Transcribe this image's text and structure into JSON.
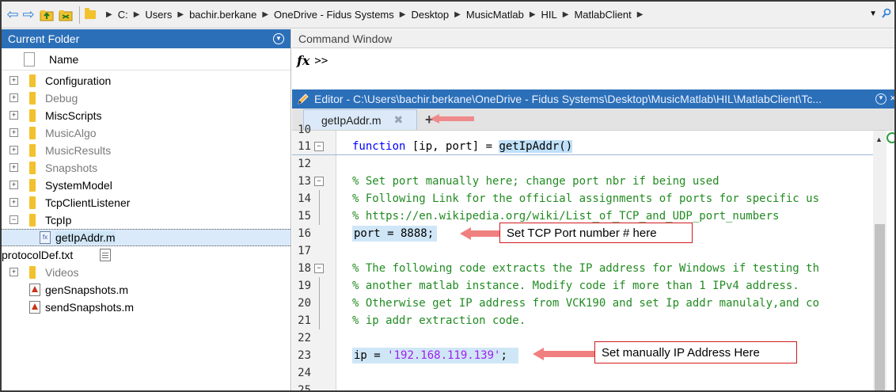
{
  "addressbar": {
    "breadcrumbs": [
      "C:",
      "Users",
      "bachir.berkane",
      "OneDrive - Fidus Systems",
      "Desktop",
      "MusicMatlab",
      "HIL",
      "MatlabClient"
    ]
  },
  "current_folder": {
    "title": "Current Folder",
    "column_name": "Name",
    "items": [
      {
        "label": "Configuration",
        "type": "folder"
      },
      {
        "label": "Debug",
        "type": "folder"
      },
      {
        "label": "MiscScripts",
        "type": "folder"
      },
      {
        "label": "MusicAlgo",
        "type": "folder"
      },
      {
        "label": "MusicResults",
        "type": "folder"
      },
      {
        "label": "Snapshots",
        "type": "folder"
      },
      {
        "label": "SystemModel",
        "type": "folder"
      },
      {
        "label": "TcpClientListener",
        "type": "folder"
      },
      {
        "label": "TcpIp",
        "type": "folder"
      },
      {
        "label": "getIpAddr.m",
        "type": "mfile"
      },
      {
        "label": "protocolDef.txt",
        "type": "txt"
      },
      {
        "label": "Videos",
        "type": "folder"
      },
      {
        "label": "genSnapshots.m",
        "type": "script"
      },
      {
        "label": "sendSnapshots.m",
        "type": "script"
      }
    ]
  },
  "command_window": {
    "title": "Command Window",
    "fx": "fx",
    "prompt": ">>"
  },
  "editor": {
    "title": "Editor - C:\\Users\\bachir.berkane\\OneDrive - Fidus Systems\\Desktop\\MusicMatlab\\HIL\\MatlabClient\\Tc...",
    "tab_label": "getIpAddr.m",
    "tab_close": "✖",
    "tab_add": "+",
    "line_numbers": [
      "10",
      "11",
      "12",
      "13",
      "14",
      "15",
      "16",
      "17",
      "18",
      "19",
      "20",
      "21",
      "22",
      "23",
      "24",
      "25"
    ],
    "code": {
      "l11_kw": "function",
      "l11_sig": " [ip, port] = ",
      "l11_fn": "getIpAddr()",
      "l13": "% Set port manually here; change port nbr if being used",
      "l14": "% Following Link for the official assignments of ports for specific us",
      "l15": "% https://en.wikipedia.org/wiki/List_of_TCP_and_UDP_port_numbers",
      "l16": "port = 8888;",
      "l18": "% The following code extracts the IP address for Windows if testing th",
      "l19": "% another matlab instance. Modify code if more than 1 IPv4 address.",
      "l20": "% Otherwise get IP address from VCK190 and set Ip addr manulaly,and co",
      "l21": "% ip addr extraction code.",
      "l23_pre": "ip = ",
      "l23_str": "'192.168.119.139'",
      "l23_post": ";"
    }
  },
  "annotations": {
    "port": "Set TCP Port number # here",
    "ip": "Set manually IP Address Here"
  },
  "colors": {
    "panel_title": "#2b6fb8",
    "annotation_border": "#d21a1a",
    "keyword": "#0000ff",
    "comment": "#228b22",
    "string": "#a020f0"
  }
}
